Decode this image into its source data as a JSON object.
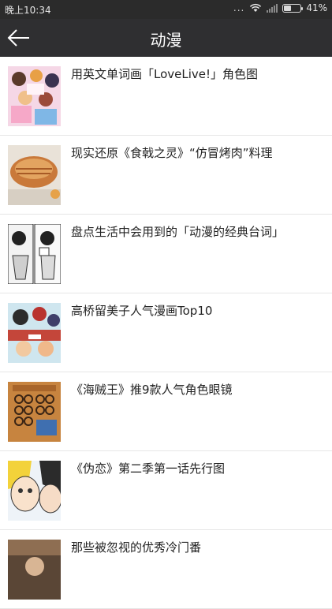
{
  "status_bar": {
    "time": "晚上10:34",
    "overflow": "...",
    "battery_percent": "41%",
    "battery_level": 0.41
  },
  "header": {
    "title": "动漫",
    "back_icon": "arrow-left-icon"
  },
  "articles": [
    {
      "title": "用英文单词画「LoveLive!」角色图"
    },
    {
      "title": "现实还原《食戟之灵》“仿冒烤肉”料理"
    },
    {
      "title": "盘点生活中会用到的「动漫的经典台词」"
    },
    {
      "title": "高桥留美子人气漫画Top10"
    },
    {
      "title": "《海贼王》推9款人气角色眼镜"
    },
    {
      "title": "《伪恋》第二季第一话先行图"
    },
    {
      "title": "那些被忽视的优秀冷门番"
    }
  ],
  "colors": {
    "status_bar_bg": "#2b2b2b",
    "title_bar_bg": "#2f2f31",
    "title_text": "#ffffff",
    "item_text": "#222222",
    "divider": "#e6e6e6"
  }
}
